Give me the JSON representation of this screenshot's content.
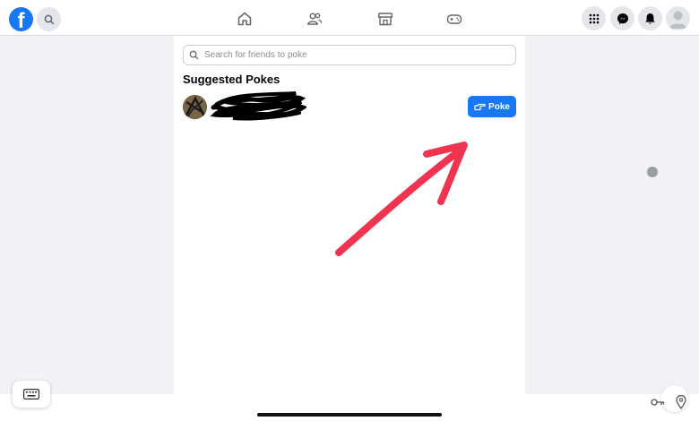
{
  "brand": {
    "logo_letter": "f"
  },
  "search": {
    "placeholder": "Search for friends to poke"
  },
  "section": {
    "title": "Suggested Pokes"
  },
  "suggestions": [
    {
      "name": "",
      "action_label": "Poke"
    }
  ],
  "colors": {
    "accent": "#1877f2",
    "annotation_arrow": "#f0344f",
    "background": "#f0f2f5"
  },
  "icons": {
    "top_left": [
      "facebook-logo",
      "search-icon"
    ],
    "nav": [
      "home-icon",
      "friends-icon",
      "marketplace-icon",
      "gaming-icon"
    ],
    "top_right": [
      "menu-grid-icon",
      "messenger-icon",
      "bell-icon",
      "profile-avatar"
    ]
  }
}
